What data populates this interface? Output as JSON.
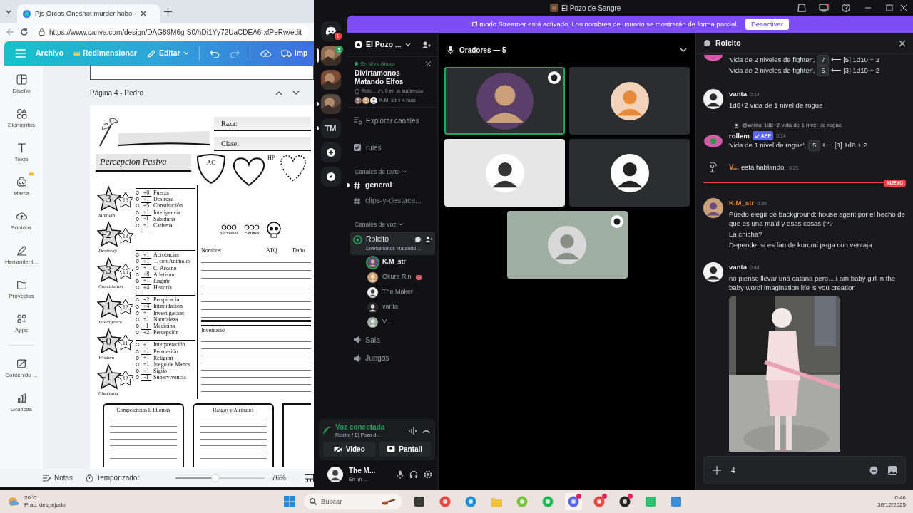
{
  "browser": {
    "tab_title": "Pjs Orcos Oneshot murder hobo -",
    "url": "https://www.canva.com/design/DAG89M6g-S0/hDi1Yy72UaCDEA6-xfPeRw/edit"
  },
  "canva_toolbar": [
    {
      "kind": "text",
      "label": "Archivo"
    },
    {
      "kind": "crown",
      "label": "Redimensionar"
    },
    {
      "kind": "pencil",
      "label": "Editar"
    },
    {
      "kind": "truck",
      "label": "Imp"
    }
  ],
  "canva_rail": [
    {
      "kind": "layout",
      "label": "Diseño",
      "premium": false
    },
    {
      "kind": "shapes",
      "label": "Elementos",
      "premium": false
    },
    {
      "kind": "text",
      "label": "Texto",
      "premium": false
    },
    {
      "kind": "brand",
      "label": "Marca",
      "premium": true
    },
    {
      "kind": "upload",
      "label": "Subidos",
      "premium": false
    },
    {
      "kind": "pen",
      "label": "Herramient...",
      "premium": false
    },
    {
      "kind": "folder",
      "label": "Proyectos",
      "premium": false
    },
    {
      "kind": "apps",
      "label": "Apps",
      "premium": false
    },
    {
      "kind": "magic",
      "label": "Contenido ...",
      "premium": false
    },
    {
      "kind": "chart",
      "label": "Gráficas",
      "premium": false
    }
  ],
  "page_title": "Página 4 - Pedro",
  "sheet": {
    "race_label": "Raza:",
    "class_label": "Clase:",
    "passive_label": "Percepcion Pasiva",
    "ac_label": "AC",
    "hp_label": "HP",
    "successes": "Successes",
    "failures": "Failures",
    "abilities": [
      {
        "mod": "+3",
        "score": "16",
        "name": "Strength"
      },
      {
        "mod": "+2",
        "score": "13",
        "name": "Dexterity"
      },
      {
        "mod": "+3",
        "score": "16",
        "name": "Constitution"
      },
      {
        "mod": "+1",
        "score": "12",
        "name": "Intelligence"
      },
      {
        "mod": "+0",
        "score": "11",
        "name": "Wisdom"
      },
      {
        "mod": "+1",
        "score": "12",
        "name": "Charisma"
      }
    ],
    "skill_groups": [
      [
        {
          "mod": "+8",
          "name": "Fuerza"
        },
        {
          "mod": "+1",
          "name": "Destreza"
        },
        {
          "mod": "+5",
          "name": "Constitución"
        },
        {
          "mod": "+1",
          "name": "Inteligencia"
        },
        {
          "mod": "-1",
          "name": "Sabiduría"
        },
        {
          "mod": "+1",
          "name": "Carisma"
        }
      ],
      [
        {
          "mod": "+1",
          "name": "Acrobacias"
        },
        {
          "mod": "+1",
          "name": "T. con Animales"
        },
        {
          "mod": "+1",
          "name": "C. Arcano"
        },
        {
          "mod": "+8",
          "name": "Atletismo"
        },
        {
          "mod": "+1",
          "name": "Engaño"
        },
        {
          "mod": "+4",
          "name": "Historia"
        }
      ],
      [
        {
          "mod": "+2",
          "name": "Perspicacia"
        },
        {
          "mod": "+4",
          "name": "Intimidación"
        },
        {
          "mod": "+1",
          "name": "Investigación"
        },
        {
          "mod": "+1",
          "name": "Naturaleza"
        },
        {
          "mod": "-1",
          "name": "Medicina"
        },
        {
          "mod": "+2",
          "name": "Percepción"
        }
      ],
      [
        {
          "mod": "+1",
          "name": "Interpretación"
        },
        {
          "mod": "+1",
          "name": "Persuasión"
        },
        {
          "mod": "+1",
          "name": "Religión"
        },
        {
          "mod": "+1",
          "name": "Juego de Manos"
        },
        {
          "mod": "+1",
          "name": "Sigilo"
        },
        {
          "mod": "-1",
          "name": "Supervivencia"
        }
      ]
    ],
    "weapon_headers": [
      "Nombre:",
      "ATQ",
      "Daño"
    ],
    "inventory_label": "Inventario",
    "boxes": [
      "Competencias E Idiomas",
      "Rasgos y Atributos"
    ]
  },
  "canva_footer": {
    "notes": "Notas",
    "timer": "Temporizador",
    "zoom": {
      "level": 0.45
    },
    "zoom_reading": "76%"
  },
  "discord": {
    "title": "El Pozo de Sangre",
    "banner": {
      "text": "El modo Streamer está activado. Los nombres de usuario se mostrarán de forma parcial.",
      "button": "Desactivar"
    },
    "servers": [
      {
        "kind": "home",
        "badge": "1",
        "selected": false,
        "unread": false
      },
      {
        "kind": "picture",
        "selected": true,
        "unread": false,
        "in_voice": true
      },
      {
        "kind": "picture",
        "selected": false,
        "unread": false,
        "in_voice": false
      },
      {
        "kind": "picture",
        "selected": false,
        "unread": true,
        "in_voice": false
      },
      {
        "kind": "initials",
        "label": "TM",
        "selected": false,
        "unread": true
      },
      {
        "kind": "add",
        "selected": false,
        "unread": false
      },
      {
        "kind": "discover",
        "selected": false,
        "unread": false
      }
    ],
    "server_name": "El Pozo ...",
    "live": {
      "label": "En Vivo Ahora",
      "title": "Divirtamonos Matando Elfos",
      "host": "Rolc...",
      "audience": "0 en la audiencia",
      "members": "K.M_str y 4 más"
    },
    "channels": [
      {
        "kind": "browse",
        "name": "Explorar canales"
      },
      {
        "kind": "rules",
        "name": "rules"
      }
    ],
    "text_category": "Canales de texto",
    "text_channels": [
      {
        "name": "general",
        "selected": true,
        "unread": true
      },
      {
        "name": "clips-y-destaca...",
        "selected": false,
        "unread": false
      }
    ],
    "voice_category": "Canales de voz",
    "voice_channels": [
      {
        "name": "Rolcito",
        "connected": true,
        "event": "Divirtamonos Matando ...",
        "members": [
          {
            "name": "K.M_str",
            "speaking": true,
            "streaming": false
          },
          {
            "name": "Okura Rin",
            "speaking": false,
            "streaming": true
          },
          {
            "name": "The Maker",
            "speaking": false,
            "streaming": false
          },
          {
            "name": "vanta",
            "speaking": false,
            "streaming": false
          },
          {
            "name": "V...",
            "speaking": false,
            "streaming": false
          }
        ]
      },
      {
        "name": "Sala",
        "connected": false
      },
      {
        "name": "Juegos",
        "connected": false
      }
    ],
    "voice_panel": {
      "status": "Voz conectada",
      "location": "Rolcito / El Pozo d...",
      "video": "Video",
      "screen": "Pantall"
    },
    "user": {
      "name": "The M...",
      "status": "En un ..."
    },
    "stage": {
      "header": "Oradores — 5",
      "tiles": [
        {
          "speaking": true,
          "badge": true,
          "color": "#2b2d31"
        },
        {
          "speaking": false,
          "badge": false,
          "color": "#2b2d31"
        },
        {
          "speaking": false,
          "badge": false,
          "color": "#e6e6e6"
        },
        {
          "speaking": false,
          "badge": false,
          "color": "#2b2d31"
        },
        {
          "speaking": false,
          "badge": true,
          "color": "#9fb0a2"
        }
      ]
    },
    "chat": {
      "title": "Rolcito",
      "messages": [
        {
          "kind": "continuation",
          "rolls": [
            {
              "label": "'vida de 2 niveles de fighter',",
              "total": "7",
              "detail": "⟵ [5] 1d10 + 2"
            },
            {
              "label": "'vida de 2 niveles de fighter',",
              "total": "5",
              "detail": "⟵ [3] 1d10 + 2"
            }
          ]
        },
        {
          "kind": "message",
          "author": "vanta",
          "color": "#f2f3f5",
          "time": "0:14",
          "lines": [
            "1d8+2 vida de 1 nivel de rogue"
          ]
        },
        {
          "kind": "bot",
          "reply_to": "@vanta",
          "reply_text": "1d8+2 vida de 1 nivel de rogue",
          "author": "rollem",
          "color": "#f2f3f5",
          "tag": "APP",
          "time": "0:14",
          "rolls": [
            {
              "label": "'vida de 1 nivel de rogue',",
              "total": "5",
              "detail": "⟵ [3] 1d8 + 2"
            }
          ]
        },
        {
          "kind": "system",
          "author": "V...",
          "color": "#e8893a",
          "text": "está hablando.",
          "time": "0:21"
        },
        {
          "kind": "divider",
          "label": "NUEVO"
        },
        {
          "kind": "message",
          "author": "K.M_str",
          "color": "#e8893a",
          "time": "0:30",
          "lines": [
            "Puedo elegir de background: house agent por el hecho de que es una maid y esas cosas (??",
            "La chicha?",
            "Depende, si es fan de kuromi pega con ventaja"
          ]
        },
        {
          "kind": "message",
          "author": "vanta",
          "color": "#f2f3f5",
          "time": "0:44",
          "lines": [
            "no pienso llevar una catana pero....i am baby girl in the baby wordl imagination life is you creation"
          ],
          "image": {
            "kind": "picture"
          }
        }
      ],
      "composer": {
        "value": "4"
      }
    }
  },
  "taskbar": {
    "temperature": "20°C",
    "weather": "Prac. despejado",
    "search": "Buscar",
    "time": "0:46",
    "date": "30/12/2025",
    "apps": [
      {
        "kind": "square",
        "color": "#3a3a3a",
        "active": false,
        "badge": false
      },
      {
        "kind": "circle",
        "color": "#e8453c",
        "active": false,
        "badge": false
      },
      {
        "kind": "circle",
        "color": "#1f8fd6",
        "active": false,
        "badge": false
      },
      {
        "kind": "folder",
        "color": "#f3c13a",
        "active": false,
        "badge": false
      },
      {
        "kind": "circle",
        "color": "#7ac143",
        "active": false,
        "badge": false
      },
      {
        "kind": "circle",
        "color": "#1db954",
        "active": false,
        "badge": false
      },
      {
        "kind": "circle",
        "color": "#5865f2",
        "active": true,
        "badge": true
      },
      {
        "kind": "circle",
        "color": "#e8453c",
        "active": false,
        "badge": true
      },
      {
        "kind": "circle",
        "color": "#222222",
        "active": false,
        "badge": true
      },
      {
        "kind": "square",
        "color": "#2fbf71",
        "active": false,
        "badge": false
      },
      {
        "kind": "square",
        "color": "#3b8ed6",
        "active": false,
        "badge": false
      }
    ]
  }
}
